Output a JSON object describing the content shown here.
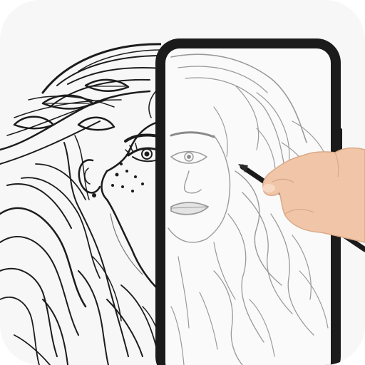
{
  "app_icon": {
    "kind": "drawing-tracer-app-icon",
    "background_color": "#f7f7f7",
    "line_color": "#1c1c1c",
    "traced_line_color": "#9a9a9a",
    "phone_frame_color": "#1b1b1b",
    "skin_color": "#f1c6a8",
    "pencil_color": "#1a1a1a"
  }
}
